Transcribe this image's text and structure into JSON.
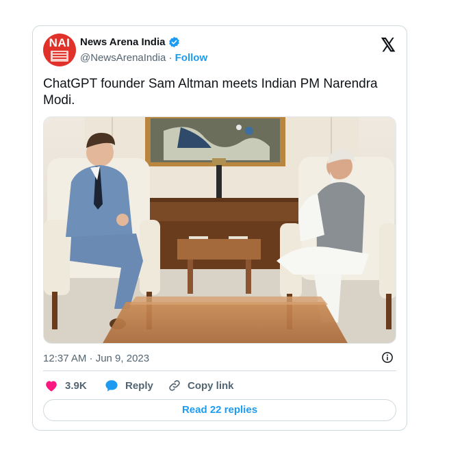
{
  "account": {
    "name": "News Arena India",
    "handle": "@NewsArenaIndia",
    "separator": "·",
    "follow_label": "Follow",
    "avatar_abbr": "NAI"
  },
  "tweet": {
    "text": "ChatGPT founder Sam Altman meets Indian PM Narendra Modi.",
    "timestamp": "12:37 AM · Jun 9, 2023"
  },
  "actions": {
    "like_count": "3.9K",
    "reply_label": "Reply",
    "copy_label": "Copy link"
  },
  "read_replies_label": "Read 22 replies",
  "icons": [
    "verified-badge-icon",
    "x-logo-icon",
    "info-icon",
    "heart-icon",
    "reply-bubble-icon",
    "link-icon"
  ],
  "colors": {
    "accent": "#1d9bf0",
    "like": "#f91880",
    "avatar_bg": "#e0322b",
    "secondary_text": "#536471"
  }
}
